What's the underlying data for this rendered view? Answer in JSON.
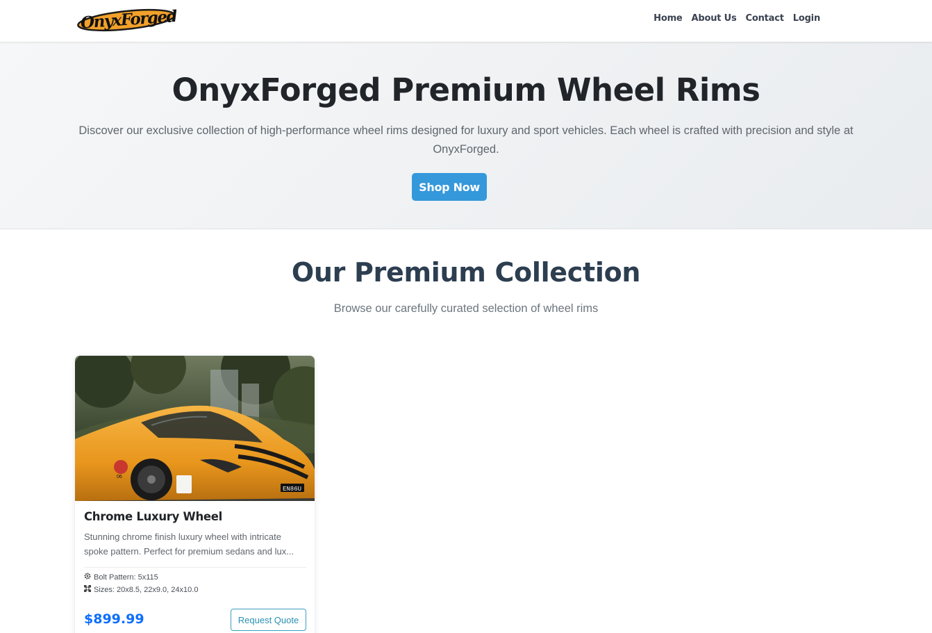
{
  "brand": {
    "logo_text": "OnyxForged"
  },
  "nav": {
    "items": [
      "Home",
      "About Us",
      "Contact",
      "Login"
    ]
  },
  "hero": {
    "title": "OnyxForged Premium Wheel Rims",
    "description": "Discover our exclusive collection of high-performance wheel rims designed for luxury and sport vehicles. Each wheel is crafted with precision and style at OnyxForged.",
    "cta_label": "Shop Now"
  },
  "collection": {
    "title": "Our Premium Collection",
    "subtitle": "Browse our carefully curated selection of wheel rims",
    "products": [
      {
        "name": "Chrome Luxury Wheel",
        "description": "Stunning chrome finish luxury wheel with intricate spoke pattern. Perfect for premium sedans and lux...",
        "bolt_pattern": "Bolt Pattern: 5x115",
        "sizes": "Sizes: 20x8.5, 22x9.0, 24x10.0",
        "price": "$899.99",
        "action_label": "Request Quote",
        "image_plate": "EN86U",
        "image_badge": "06"
      }
    ]
  },
  "colors": {
    "accent": "#3498db",
    "price": "#0d6efd",
    "heading": "#2c3e50",
    "car": "#f0a227"
  }
}
